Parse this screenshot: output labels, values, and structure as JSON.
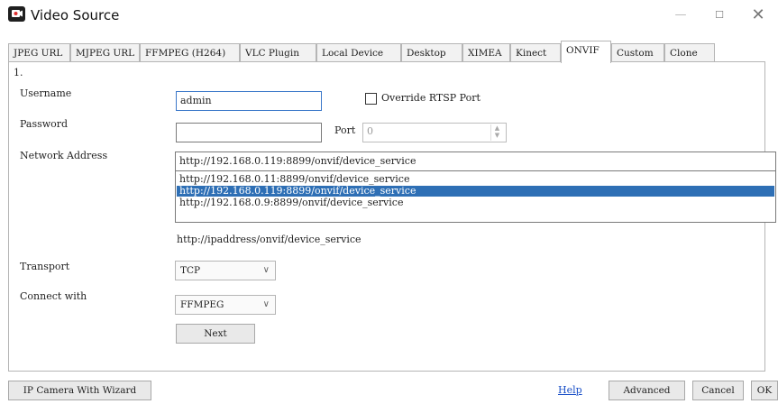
{
  "window": {
    "title": "Video Source",
    "controls": {
      "minimize": "—",
      "maximize": "☐",
      "close": "✕"
    }
  },
  "tabs": [
    {
      "label": "JPEG URL",
      "active": false
    },
    {
      "label": "MJPEG URL",
      "active": false
    },
    {
      "label": "FFMPEG (H264)",
      "active": false
    },
    {
      "label": "VLC Plugin",
      "active": false
    },
    {
      "label": "Local Device",
      "active": false
    },
    {
      "label": "Desktop",
      "active": false
    },
    {
      "label": "XIMEA",
      "active": false
    },
    {
      "label": "Kinect",
      "active": false
    },
    {
      "label": "ONVIF",
      "active": true
    },
    {
      "label": "Custom",
      "active": false
    },
    {
      "label": "Clone",
      "active": false
    }
  ],
  "form": {
    "step": "1.",
    "username_label": "Username",
    "username_value": "admin",
    "override_rtsp_label": "Override RTSP Port",
    "override_rtsp_checked": false,
    "password_label": "Password",
    "password_value": "",
    "port_label": "Port",
    "port_value": "0",
    "network_address_label": "Network Address",
    "network_address_value": "http://192.168.0.119:8899/onvif/device_service",
    "address_options": [
      "http://192.168.0.11:8899/onvif/device_service",
      "http://192.168.0.119:8899/onvif/device_service",
      "http://192.168.0.9:8899/onvif/device_service"
    ],
    "address_selected_index": 1,
    "address_hint": "http://ipaddress/onvif/device_service",
    "transport_label": "Transport",
    "transport_value": "TCP",
    "connect_label": "Connect with",
    "connect_value": "FFMPEG",
    "next_label": "Next"
  },
  "footer": {
    "wizard_label": "IP Camera With Wizard",
    "help_label": "Help",
    "advanced_label": "Advanced",
    "cancel_label": "Cancel",
    "ok_label": "OK"
  },
  "colors": {
    "selection": "#2e6fb5",
    "link": "#1a4fc7"
  }
}
